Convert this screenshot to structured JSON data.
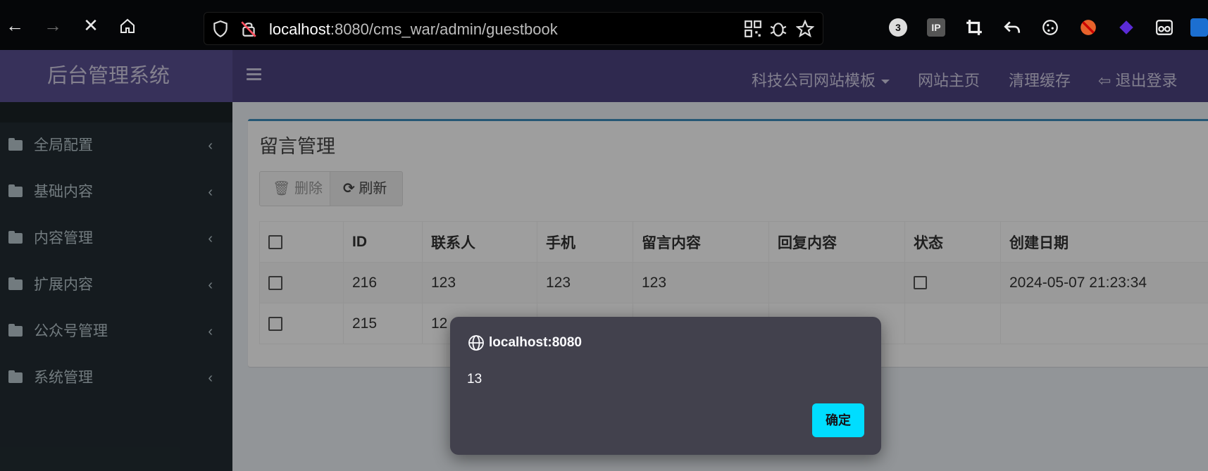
{
  "browser": {
    "url_host": "localhost",
    "url_rest": ":8080/cms_war/admin/guestbook",
    "tab_count_badge": "3",
    "ext_ip_label": "IP"
  },
  "app": {
    "brand": "后台管理系统",
    "topnav": {
      "template_menu": "科技公司网站模板",
      "site_home": "网站主页",
      "clear_cache": "清理缓存",
      "logout": "退出登录"
    },
    "sidebar": {
      "items": [
        {
          "label": "全局配置"
        },
        {
          "label": "基础内容"
        },
        {
          "label": "内容管理"
        },
        {
          "label": "扩展内容"
        },
        {
          "label": "公众号管理"
        },
        {
          "label": "系统管理"
        }
      ]
    },
    "box": {
      "title": "留言管理",
      "delete_label": "删除",
      "refresh_label": "刷新"
    },
    "table": {
      "headers": [
        "ID",
        "联系人",
        "手机",
        "留言内容",
        "回复内容",
        "状态",
        "创建日期"
      ],
      "rows": [
        {
          "id": "216",
          "contact": "123",
          "phone": "123",
          "message": "123",
          "reply": "",
          "created": "2024-05-07 21:23:34"
        },
        {
          "id": "215",
          "contact": "12",
          "phone": "",
          "message": "",
          "reply": "",
          "created": ""
        }
      ]
    }
  },
  "dialog": {
    "origin": "localhost:8080",
    "message": "13",
    "ok_label": "确定"
  },
  "colors": {
    "brand_bg": "#5a4f91",
    "topnav_bg": "#4c4380",
    "sidebar_bg": "#222d32",
    "box_accent": "#3c8dbc",
    "dialog_bg": "#42414d",
    "ok_button": "#00ddff"
  }
}
